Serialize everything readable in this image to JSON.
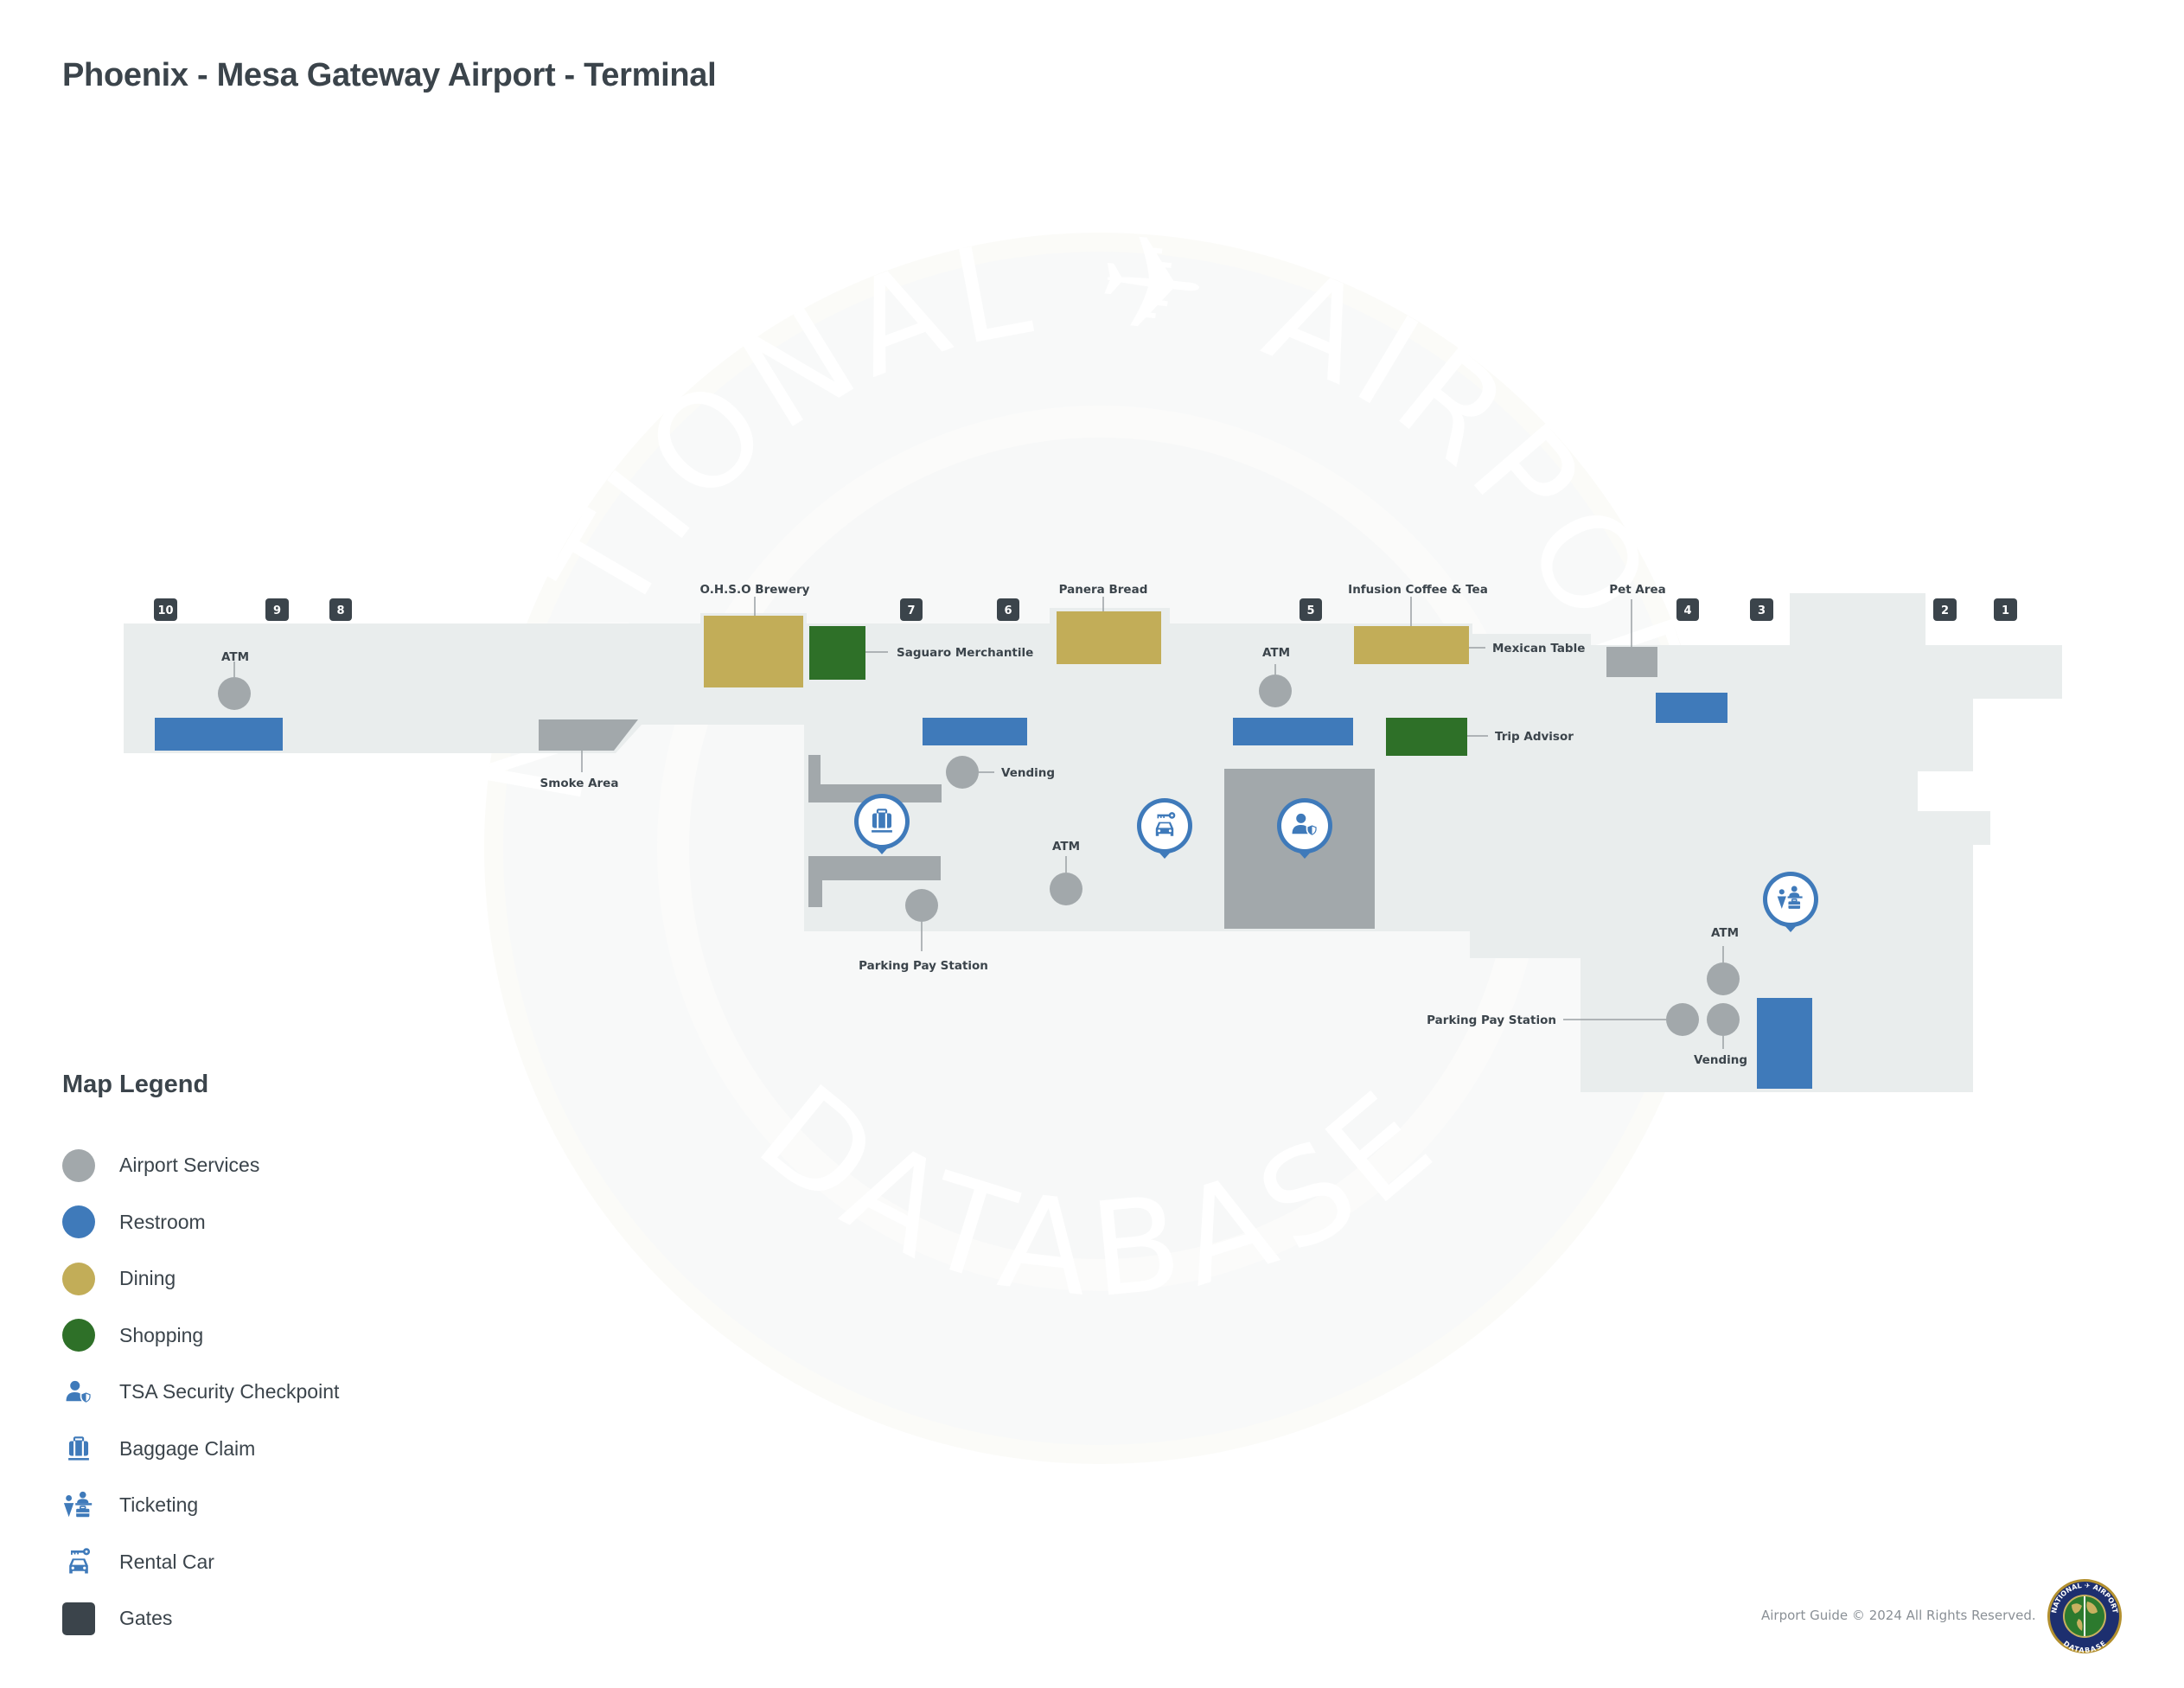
{
  "title": "Phoenix - Mesa Gateway Airport - Terminal",
  "colors": {
    "floor": "#e7ebec",
    "airport_services": "#a2a8ab",
    "restroom": "#3f7aba",
    "dining": "#c2ad58",
    "shopping": "#2e7028",
    "gate": "#3b444b",
    "text": "#3b444b",
    "watermark": "#f4f5f3"
  },
  "gates": [
    "10",
    "9",
    "8",
    "7",
    "6",
    "5",
    "4",
    "3",
    "2",
    "1"
  ],
  "labels": {
    "atm_west": "ATM",
    "smoke_area": "Smoke Area",
    "ohso_brewery": "O.H.S.O Brewery",
    "saguaro_merchantile": "Saguaro Merchantile",
    "panera_bread": "Panera Bread",
    "atm_central": "ATM",
    "infusion_coffee": "Infusion Coffee & Tea",
    "mexican_table": "Mexican Table",
    "pet_area": "Pet Area",
    "trip_advisor": "Trip Advisor",
    "vending_central": "Vending",
    "atm_baggage": "ATM",
    "parking_central": "Parking Pay Station",
    "atm_east": "ATM",
    "parking_east": "Parking Pay Station",
    "vending_east": "Vending"
  },
  "pins": {
    "baggage_claim": "baggage-claim-icon",
    "rental_car": "rental-car-icon",
    "tsa": "tsa-security-icon",
    "ticketing": "ticketing-icon"
  },
  "watermark": {
    "top": "NATIONAL ✈ AIRPORT",
    "bottom": "DATABASE"
  },
  "legend": {
    "title": "Map Legend",
    "items": [
      {
        "label": "Airport Services",
        "icon": "dot",
        "color": "#a2a8ab"
      },
      {
        "label": "Restroom",
        "icon": "dot",
        "color": "#3f7aba"
      },
      {
        "label": "Dining",
        "icon": "dot",
        "color": "#c2ad58"
      },
      {
        "label": "Shopping",
        "icon": "dot",
        "color": "#2e7028"
      },
      {
        "label": "TSA  Security Checkpoint",
        "icon": "tsa-security-icon"
      },
      {
        "label": "Baggage Claim",
        "icon": "baggage-claim-icon"
      },
      {
        "label": "Ticketing",
        "icon": "ticketing-icon"
      },
      {
        "label": "Rental Car",
        "icon": "rental-car-icon"
      },
      {
        "label": "Gates",
        "icon": "square",
        "color": "#3b444b"
      }
    ]
  },
  "footer": {
    "copyright": "Airport Guide © 2024 All Rights Reserved.",
    "seal_top": "NATIONAL ✈ AIRPORT",
    "seal_bottom": "DATABASE"
  }
}
